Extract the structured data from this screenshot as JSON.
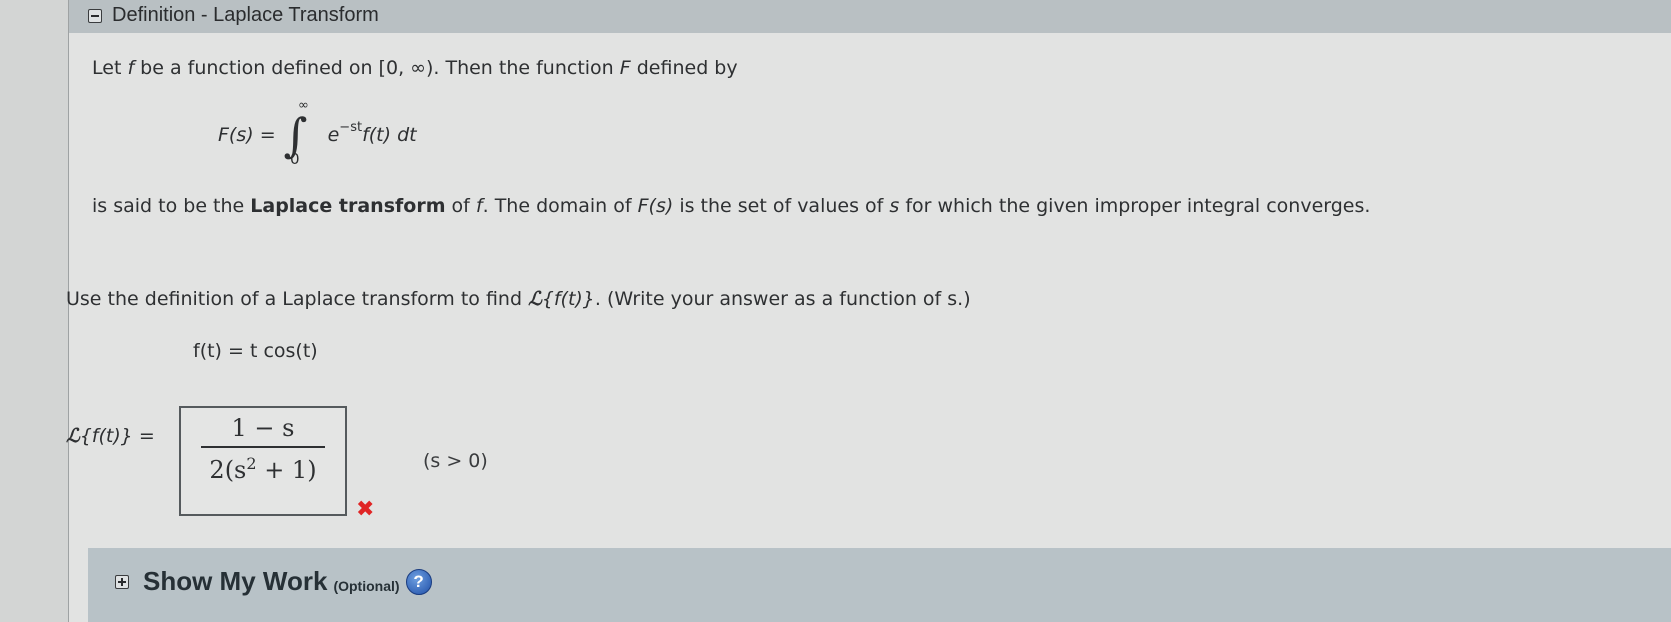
{
  "header": {
    "title": "Definition - Laplace Transform",
    "collapse_icon": "minus-box-icon"
  },
  "definition": {
    "line1_a": "Let ",
    "line1_f": "f",
    "line1_b": " be a function defined on [0, ∞). Then the function ",
    "line1_F": "F",
    "line1_c": " defined by",
    "formula_lhs": "F(s) = ",
    "integral_symbol": "∫",
    "integral_upper": "∞",
    "integral_lower": "0",
    "integrand_e": "e",
    "integrand_exp": "−st",
    "integrand_rest": "f(t) dt",
    "line2_a": "is said to be the ",
    "line2_bold": "Laplace transform",
    "line2_b": " of ",
    "line2_f": "f",
    "line2_c": ". The domain of ",
    "line2_Fs": "F(s)",
    "line2_d": " is the set of values of ",
    "line2_s": "s",
    "line2_e": " for which the given improper integral converges."
  },
  "question": {
    "prompt_a": "Use the definition of a Laplace transform to find ",
    "prompt_L": "ℒ",
    "prompt_Lf": "{f(t)}",
    "prompt_b": ". (Write your answer as a function of s.)",
    "function": "f(t) = t cos(t)",
    "answer_label_L": "ℒ",
    "answer_label_rest": "{f(t)} = ",
    "answer_numerator": "1 − s",
    "answer_denominator_a": "2(s",
    "answer_denominator_exp": "2",
    "answer_denominator_b": " + 1)",
    "answer_status": "incorrect",
    "answer_status_icon": "red-x-icon",
    "condition": "(s > 0)"
  },
  "show_work": {
    "expand_icon": "plus-box-icon",
    "title": "Show My Work",
    "optional": "(Optional)",
    "help_icon": "question-circle-icon"
  }
}
